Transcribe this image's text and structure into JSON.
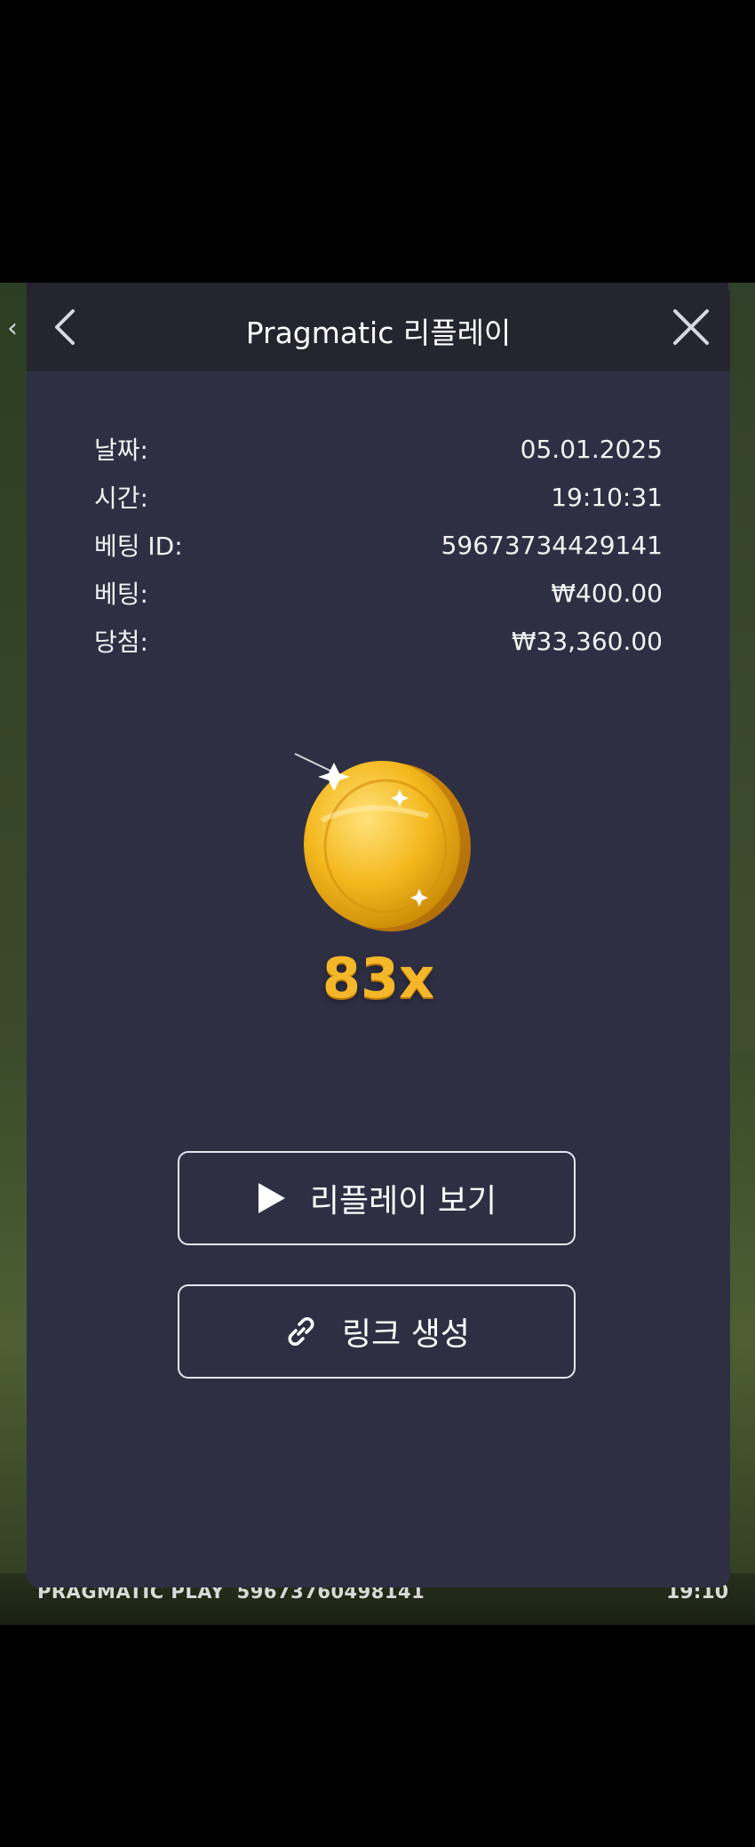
{
  "game": {
    "footer_brand": "PRAGMATIC PLAY",
    "footer_id": "59673760498141",
    "footer_time": "19:10",
    "left_arrow": "‹"
  },
  "modal": {
    "title": "Pragmatic 리플레이",
    "back_icon": "chevron-left-icon",
    "close_icon": "close-icon",
    "info": [
      {
        "label": "날짜:",
        "value": "05.01.2025"
      },
      {
        "label": "시간:",
        "value": "19:10:31"
      },
      {
        "label": "베팅 ID:",
        "value": "59673734429141"
      },
      {
        "label": "베팅:",
        "value": "₩400.00"
      },
      {
        "label": "당첨:",
        "value": "₩33,360.00"
      }
    ],
    "multiplier": "83x",
    "buttons": {
      "replay_label": "리플레이 보기",
      "replay_icon": "play-icon",
      "link_label": "링크 생성",
      "link_icon": "link-icon"
    }
  },
  "colors": {
    "modal_bg": "#2f2f44",
    "header_bg": "#25252f",
    "multiplier": "#f5b72a",
    "coin": "#f2b01a"
  }
}
